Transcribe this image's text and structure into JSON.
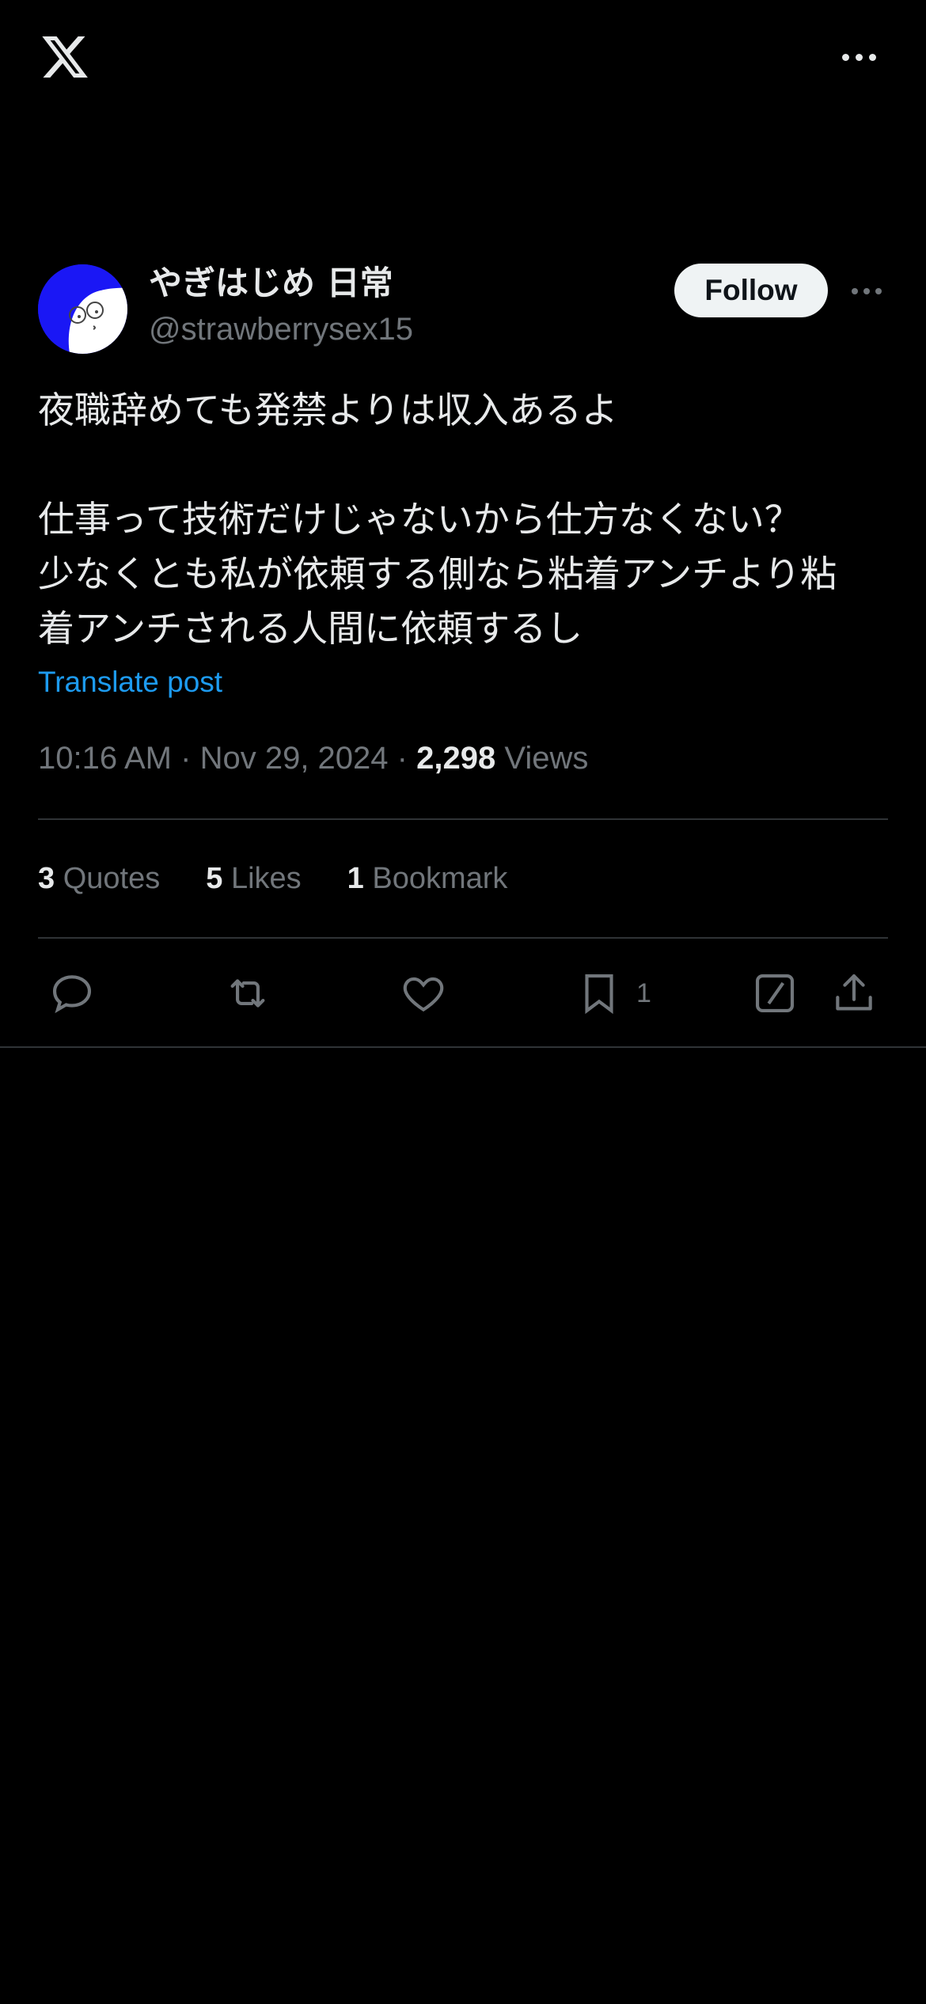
{
  "app": {
    "logo": "x-logo-icon"
  },
  "author": {
    "display_name": "やぎはじめ 日常",
    "handle": "@strawberrysex15",
    "follow_label": "Follow",
    "avatar_bg": "#1a17f5"
  },
  "tweet": {
    "text": "夜職辞めても発禁よりは収入あるよ\n\n仕事って技術だけじゃないから仕方なくない？\n少なくとも私が依頼する側なら粘着アンチより粘\n着アンチされる人間に依頼するし",
    "translate_label": "Translate post",
    "time": "10:16 AM",
    "date": "Nov 29, 2024",
    "views_count": "2,298",
    "views_label": "Views",
    "separator": "·"
  },
  "stats": [
    {
      "count": "3",
      "label": "Quotes"
    },
    {
      "count": "5",
      "label": "Likes"
    },
    {
      "count": "1",
      "label": "Bookmark"
    }
  ],
  "actions": {
    "reply_icon": "reply-icon",
    "retweet_icon": "retweet-icon",
    "like_icon": "heart-icon",
    "bookmark_icon": "bookmark-icon",
    "bookmark_count": "1",
    "grok_icon": "grok-icon",
    "share_icon": "share-icon"
  },
  "colors": {
    "background": "#000000",
    "text": "#e7e9ea",
    "muted": "#71767b",
    "link": "#1d9bf0",
    "divider": "#2f3336"
  }
}
